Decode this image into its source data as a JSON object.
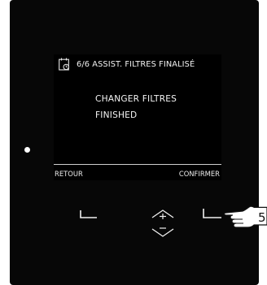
{
  "screen": {
    "header_title": "6/6 ASSIST. FILTRES FINALISÉ",
    "header_icon": "calendar-clock-icon",
    "message_line1": "CHANGER FILTRES",
    "message_line2": "FINISHED",
    "soft_left_label": "RETOUR",
    "soft_right_label": "CONFIRMER"
  },
  "panel": {
    "led_indicator": "status-led",
    "keys": [
      "left-soft-key",
      "up-plus-key",
      "right-soft-key",
      "down-minus-key"
    ]
  },
  "callout": {
    "number": "5",
    "icon": "pointing-hand-icon"
  },
  "colors": {
    "panel_bg": "#070707",
    "screen_text": "#f2f2f2",
    "page_bg": "#ffffff"
  }
}
